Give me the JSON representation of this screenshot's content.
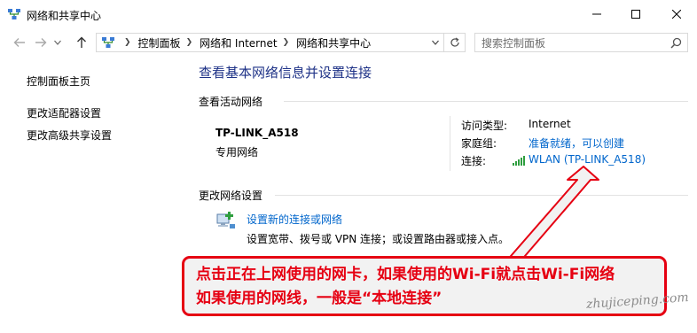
{
  "window": {
    "title": "网络和共享中心"
  },
  "address_bar": {
    "breadcrumbs": [
      "控制面板",
      "网络和 Internet",
      "网络和共享中心"
    ]
  },
  "search": {
    "placeholder": "搜索控制面板"
  },
  "left_nav": {
    "items": [
      {
        "label": "控制面板主页"
      },
      {
        "label": "更改适配器设置"
      },
      {
        "label": "更改高级共享设置"
      }
    ]
  },
  "main": {
    "title": "查看基本网络信息并设置连接",
    "active_networks_heading": "查看活动网络",
    "network": {
      "name": "TP-LINK_A518",
      "type": "专用网络",
      "access_type_label": "访问类型:",
      "access_type_value": "Internet",
      "homegroup_label": "家庭组:",
      "homegroup_value": "准备就绪，可以创建",
      "connection_label": "连接:",
      "connection_value": "WLAN (TP-LINK_A518)"
    },
    "change_settings_heading": "更改网络设置",
    "tasks": [
      {
        "title": "设置新的连接或网络",
        "description": "设置宽带、拨号或 VPN 连接；或设置路由器或接入点。"
      }
    ]
  },
  "annotation": {
    "line1": "点击正在上网使用的网卡，如果使用的Wi-Fi就点击Wi-Fi网络",
    "line2": "如果使用的网线，一般是“本地连接”",
    "watermark": "zhujiceping.com",
    "color": "#e60012"
  },
  "icons": {
    "app": "network-sharing-icon",
    "wifi": "wifi-signal-icon",
    "task": "new-connection-icon"
  },
  "colors": {
    "link": "#0066cc",
    "heading": "#1e3287"
  }
}
